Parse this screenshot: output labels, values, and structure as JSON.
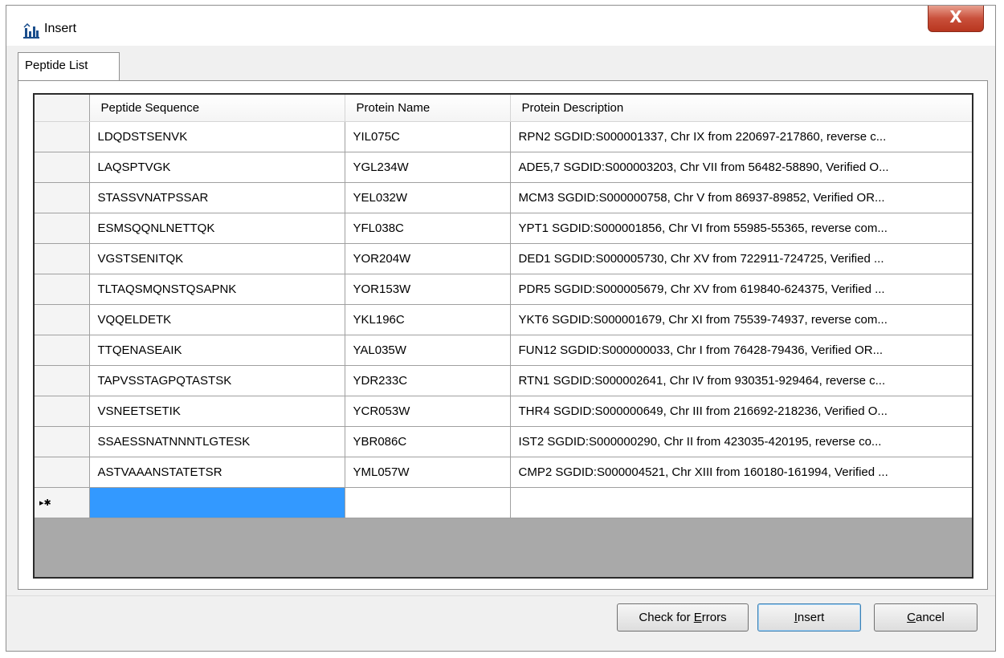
{
  "window": {
    "title": "Insert",
    "close_glyph": "X"
  },
  "tabs": [
    {
      "label": "Peptide List",
      "active": true
    }
  ],
  "grid": {
    "columns": [
      "Peptide Sequence",
      "Protein Name",
      "Protein Description"
    ],
    "rows": [
      [
        "LDQDSTSENVK",
        "YIL075C",
        "RPN2 SGDID:S000001337, Chr IX from 220697-217860, reverse c..."
      ],
      [
        "LAQSPTVGK",
        "YGL234W",
        "ADE5,7 SGDID:S000003203, Chr VII from 56482-58890, Verified O..."
      ],
      [
        "STASSVNATPSSAR",
        "YEL032W",
        "MCM3 SGDID:S000000758, Chr V from 86937-89852, Verified OR..."
      ],
      [
        "ESMSQQNLNETTQK",
        "YFL038C",
        "YPT1 SGDID:S000001856, Chr VI from 55985-55365, reverse com..."
      ],
      [
        "VGSTSENITQK",
        "YOR204W",
        "DED1 SGDID:S000005730, Chr XV from 722911-724725, Verified ..."
      ],
      [
        "TLTAQSMQNSTQSAPNK",
        "YOR153W",
        "PDR5 SGDID:S000005679, Chr XV from 619840-624375, Verified ..."
      ],
      [
        "VQQELDETK",
        "YKL196C",
        "YKT6 SGDID:S000001679, Chr XI from 75539-74937, reverse com..."
      ],
      [
        "TTQENASEAIK",
        "YAL035W",
        "FUN12 SGDID:S000000033, Chr I from 76428-79436, Verified OR..."
      ],
      [
        "TAPVSSTAGPQTASTSK",
        "YDR233C",
        "RTN1 SGDID:S000002641, Chr IV from 930351-929464, reverse c..."
      ],
      [
        "VSNEETSETIK",
        "YCR053W",
        "THR4 SGDID:S000000649, Chr III from 216692-218236, Verified O..."
      ],
      [
        "SSAESSNATNNNTLGTESK",
        "YBR086C",
        "IST2 SGDID:S000000290, Chr II from 423035-420195, reverse co..."
      ],
      [
        "ASTVAAANSTATETSR",
        "YML057W",
        "CMP2 SGDID:S000004521, Chr XIII from 160180-161994, Verified ..."
      ]
    ],
    "new_row_marker": "▸✱"
  },
  "buttons": {
    "check_errors": {
      "prefix": "Check for ",
      "mnemonic": "E",
      "suffix": "rrors"
    },
    "insert": {
      "prefix": "",
      "mnemonic": "I",
      "suffix": "nsert"
    },
    "cancel": {
      "prefix": "",
      "mnemonic": "C",
      "suffix": "ancel"
    }
  },
  "colors": {
    "selection": "#3399ff",
    "close_button": "#c9503b"
  },
  "icons": {
    "title": "bar-chart-icon"
  }
}
